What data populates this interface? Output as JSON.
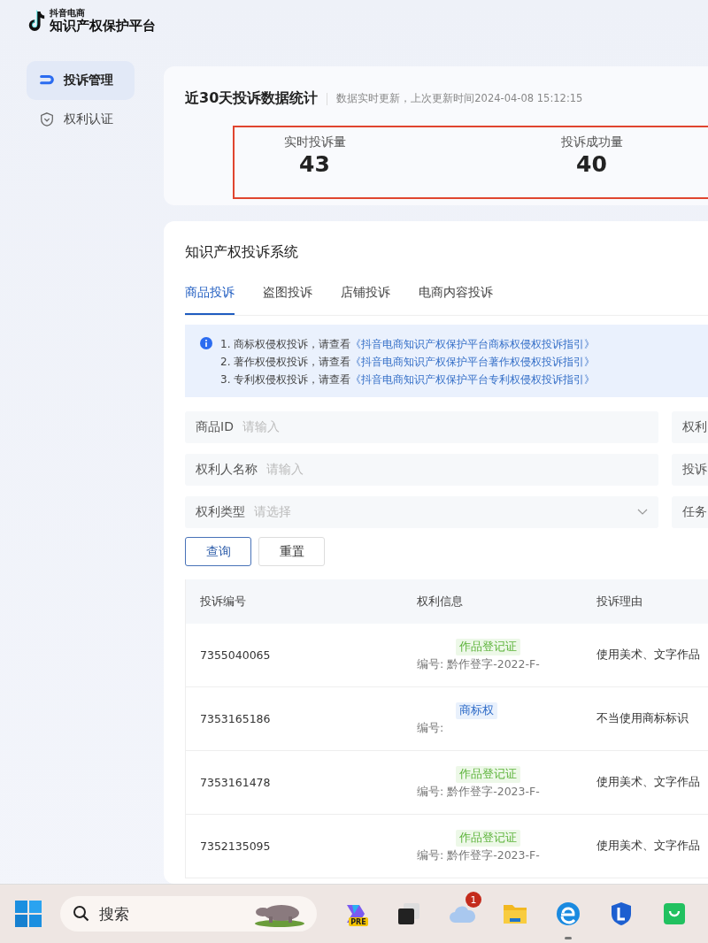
{
  "brand": {
    "small": "抖音电商",
    "title": "知识产权保护平台"
  },
  "sidebar": {
    "items": [
      {
        "label": "投诉管理",
        "kind": "complaint",
        "selected": true
      },
      {
        "label": "权利认证",
        "kind": "shield",
        "selected": false
      }
    ]
  },
  "stats": {
    "title": "近30天投诉数据统计",
    "subtitle": "数据实时更新，上次更新时间2024-04-08 15:12:15",
    "metrics": [
      {
        "label": "实时投诉量",
        "value": "43"
      },
      {
        "label": "投诉成功量",
        "value": "40"
      }
    ]
  },
  "system": {
    "title": "知识产权投诉系统",
    "tabs": [
      {
        "label": "商品投诉",
        "selected": true
      },
      {
        "label": "盗图投诉",
        "selected": false
      },
      {
        "label": "店铺投诉",
        "selected": false
      },
      {
        "label": "电商内容投诉",
        "selected": false
      }
    ],
    "notice": [
      {
        "text": "1. 商标权侵权投诉，请查看",
        "link": "《抖音电商知识产权保护平台商标权侵权投诉指引》"
      },
      {
        "text": "2. 著作权侵权投诉，请查看",
        "link": "《抖音电商知识产权保护平台著作权侵权投诉指引》"
      },
      {
        "text": "3. 专利权侵权投诉，请查看",
        "link": "《抖音电商知识产权保护平台专利权侵权投诉指引》"
      }
    ],
    "filters": [
      {
        "label": "商品ID",
        "placeholder": "请输入",
        "kind": "input"
      },
      {
        "label": "权利",
        "kind": "cut"
      },
      {
        "label": "权利人名称",
        "placeholder": "请输入",
        "kind": "input"
      },
      {
        "label": "投诉",
        "kind": "cut"
      },
      {
        "label": "权利类型",
        "placeholder": "请选择",
        "kind": "select"
      },
      {
        "label": "任务",
        "kind": "cut"
      }
    ],
    "buttons": [
      {
        "label": "查询",
        "kind": "primary"
      },
      {
        "label": "重置",
        "kind": "default"
      }
    ],
    "table": {
      "columns": [
        "投诉编号",
        "权利信息",
        "投诉理由"
      ],
      "rows": [
        {
          "id": "7355040065",
          "tag": "作品登记证",
          "kind": "copyright",
          "number": "编号: 黔作登字-2022-F-",
          "reason": "使用美术、文字作品"
        },
        {
          "id": "7353165186",
          "tag": "商标权",
          "kind": "trademark",
          "number": "编号:",
          "reason": "不当使用商标标识"
        },
        {
          "id": "7353161478",
          "tag": "作品登记证",
          "kind": "copyright",
          "number": "编号: 黔作登字-2023-F-",
          "reason": "使用美术、文字作品"
        },
        {
          "id": "7352135095",
          "tag": "作品登记证",
          "kind": "copyright",
          "number": "编号: 黔作登字-2023-F-",
          "reason": "使用美术、文字作品"
        }
      ]
    }
  },
  "taskbar": {
    "search": "搜索",
    "apps": [
      {
        "kind": "copilot",
        "label": "PRE"
      },
      {
        "kind": "windows"
      },
      {
        "kind": "cloud",
        "badge": "1"
      },
      {
        "kind": "folder"
      },
      {
        "kind": "edge",
        "running": true
      },
      {
        "kind": "shield"
      },
      {
        "kind": "bag"
      }
    ]
  }
}
